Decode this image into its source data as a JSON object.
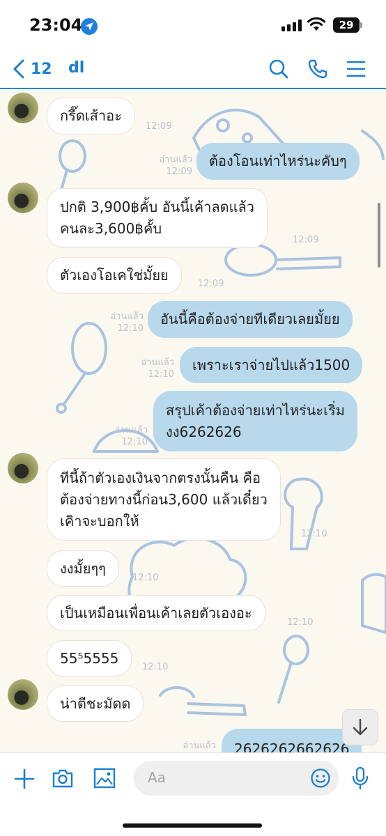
{
  "status_bar": {
    "time": "23:04",
    "battery": "29"
  },
  "header": {
    "back_count": "12",
    "title": "dl"
  },
  "messages": [
    {
      "text": "กรี๊ดเส้าอะ",
      "time": "12:09"
    },
    {
      "read": "อ่านแล้ว",
      "time": "12:09",
      "text": "ต้องโอนเท่าไหร่นะคับๆ"
    },
    {
      "text": "ปกติ 3,900฿คั้บ อันนี้เค้าลดแล้ว\nคนละ3,600฿คั้บ",
      "time": "12:09"
    },
    {
      "text": "ตัวเองโอเคใช่มั้ยย",
      "time": "12:09"
    },
    {
      "read": "อ่านแล้ว",
      "time": "12:10",
      "text": "อันนี้คือต้องจ่ายทีเดียวเลยมั้ยย"
    },
    {
      "read": "อ่านแล้ว",
      "time": "12:10",
      "text": "เพราะเราจ่ายไปแล้ว1500"
    },
    {
      "read": "อ่านแล้ว",
      "time": "12:10",
      "text": "สรุปเค้าต้องจ่ายเท่าไหร่นะเริ่ม\nงง6262626"
    },
    {
      "text": "ทีนี้ถ้าตัวเองเงินจากตรงนั้นคืน คือ\nต้องจ่ายทางนี้ก่อน3,600 แล้วเดี๋ยว\nเคิาจะบอกให้",
      "time": "12:10"
    },
    {
      "text": "งงมั้ยๆๆ",
      "time": "12:10"
    },
    {
      "text": "เป็นเหมือนเพื่อนเค้าเลยตัวเองอะ",
      "time": "12:10"
    },
    {
      "text": "55⁵5555",
      "time": "12:10"
    },
    {
      "text": "น่าตีชะมัดด",
      "time": ""
    },
    {
      "read": "อ่านแล้ว",
      "text": "2626262662626"
    }
  ],
  "input": {
    "placeholder": "Aa"
  },
  "colors": {
    "accent": "#1a7fd0",
    "outgoing_bubble": "#b8d8ec",
    "chat_bg": "#fbf8ef"
  }
}
